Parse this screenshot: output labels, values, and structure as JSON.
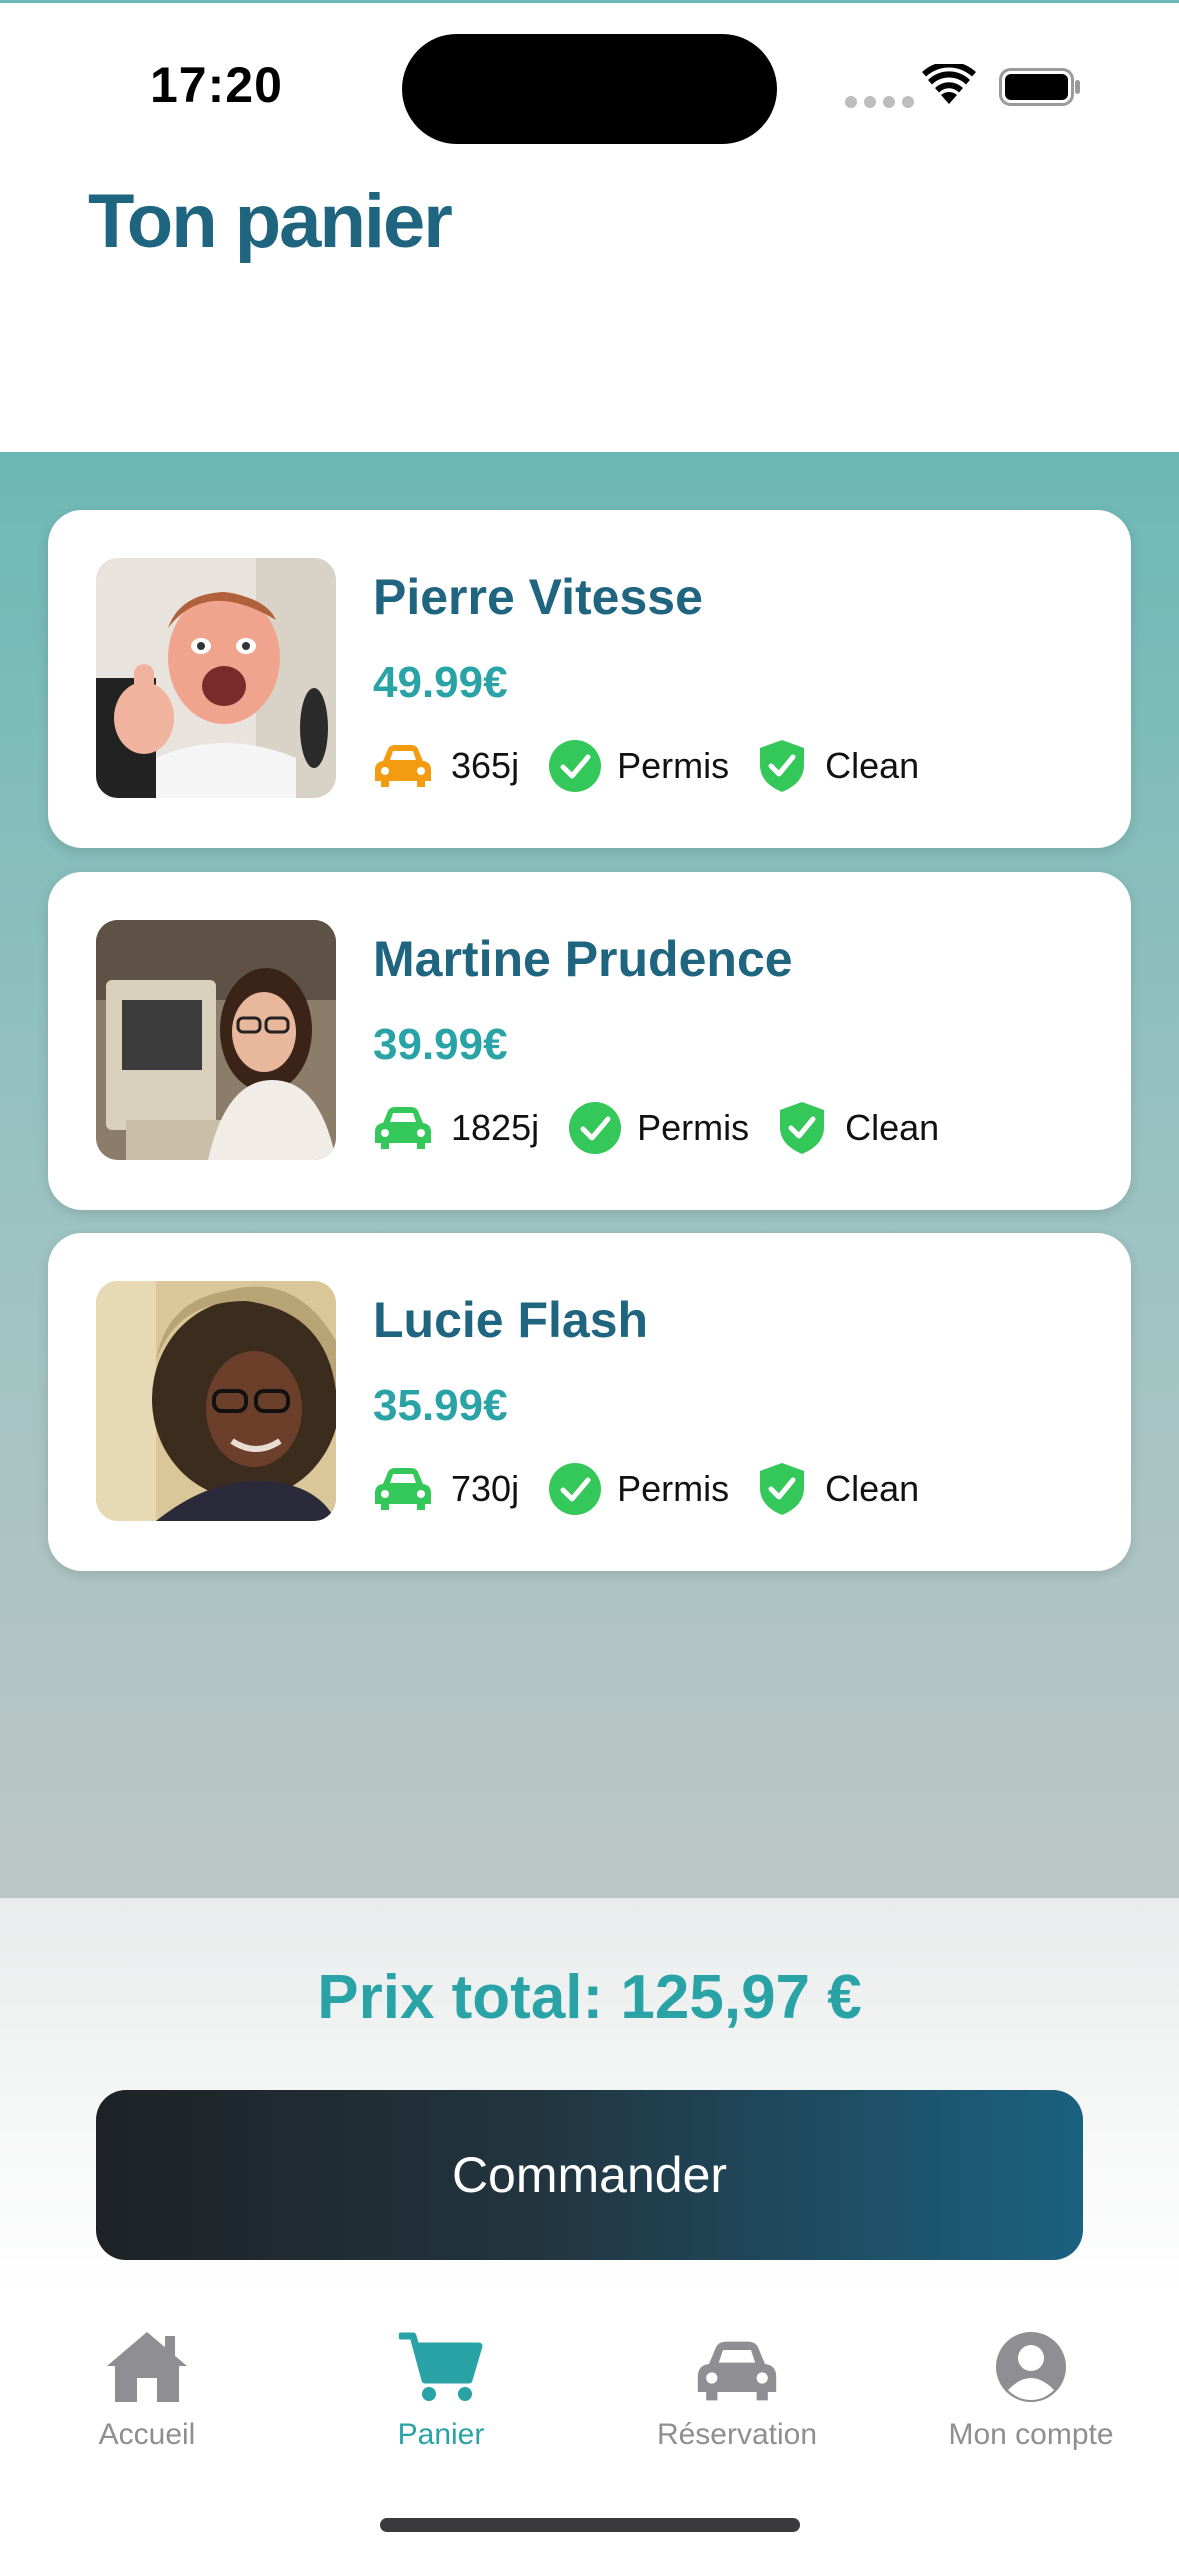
{
  "status_bar": {
    "time": "17:20"
  },
  "page": {
    "title": "Ton panier"
  },
  "cart_items": [
    {
      "name": "Pierre Vitesse",
      "price": "49.99€",
      "days": "365j",
      "car_icon_color": "#f39c12",
      "permis_label": "Permis",
      "clean_label": "Clean"
    },
    {
      "name": "Martine Prudence",
      "price": "39.99€",
      "days": "1825j",
      "car_icon_color": "#34c759",
      "permis_label": "Permis",
      "clean_label": "Clean"
    },
    {
      "name": "Lucie Flash",
      "price": "35.99€",
      "days": "730j",
      "car_icon_color": "#34c759",
      "permis_label": "Permis",
      "clean_label": "Clean"
    }
  ],
  "summary": {
    "total_label": "Prix total: 125,97 €",
    "order_button": "Commander"
  },
  "tab_bar": {
    "tabs": [
      {
        "label": "Accueil",
        "icon": "home-icon",
        "active": false
      },
      {
        "label": "Panier",
        "icon": "cart-icon",
        "active": true
      },
      {
        "label": "Réservation",
        "icon": "car-icon",
        "active": false
      },
      {
        "label": "Mon compte",
        "icon": "account-icon",
        "active": false
      }
    ]
  },
  "colors": {
    "title": "#1f6580",
    "accent": "#2aa3a6",
    "inactive_tab": "#8e8e93",
    "success": "#34c759",
    "warning": "#f39c12"
  }
}
